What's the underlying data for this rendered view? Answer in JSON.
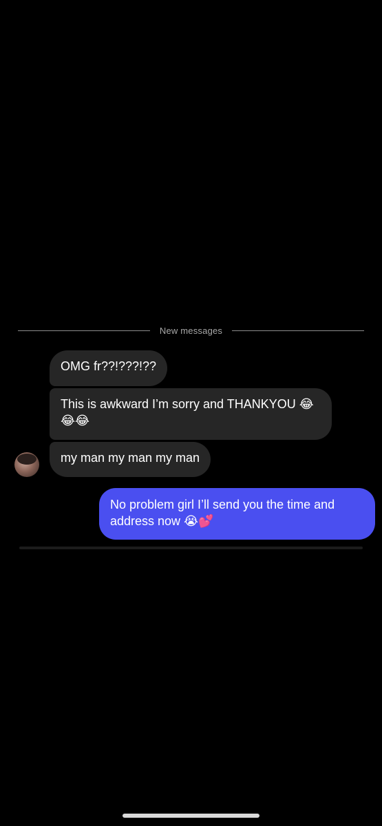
{
  "thread": {
    "divider_label": "New messages",
    "messages": [
      {
        "sender": "them",
        "text": "OMG fr??!???!??"
      },
      {
        "sender": "them",
        "text": "This is awkward I’m sorry and THANKYOU 😂😂😂"
      },
      {
        "sender": "them",
        "text": "my man my man my man"
      },
      {
        "sender": "me",
        "text": "No problem girl I’ll send you the time and address now 😭💕"
      }
    ]
  },
  "colors": {
    "background": "#000000",
    "incoming_bubble": "#262626",
    "outgoing_bubble": "#4a4ff0",
    "divider_text": "#a8a8a8"
  },
  "icons": {
    "avatar": "contact-avatar"
  }
}
